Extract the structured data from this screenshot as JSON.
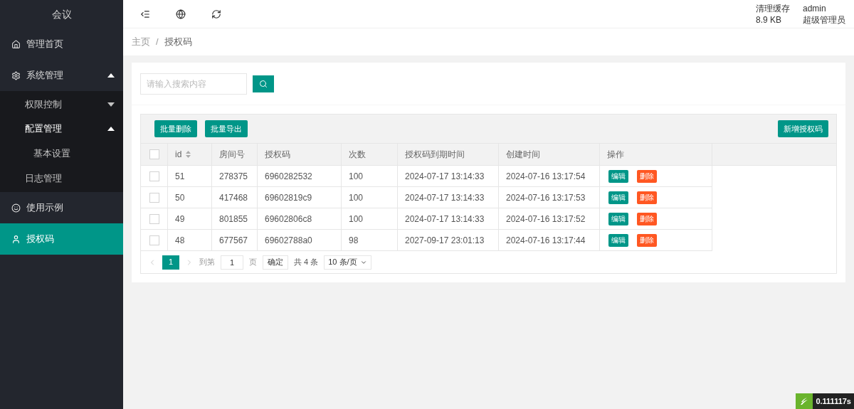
{
  "sidebar": {
    "title": "会议",
    "items": [
      {
        "label": "管理首页",
        "selected": false
      },
      {
        "label": "系统管理",
        "selected": false,
        "expanded": true,
        "children": [
          {
            "label": "权限控制",
            "expanded": false
          },
          {
            "label": "配置管理",
            "expanded": true,
            "children": [
              {
                "label": "基本设置"
              }
            ]
          },
          {
            "label": "日志管理"
          }
        ]
      },
      {
        "label": "使用示例",
        "selected": false
      },
      {
        "label": "授权码",
        "selected": true
      }
    ]
  },
  "header": {
    "cache_label": "清理缓存",
    "cache_size": "8.9 KB",
    "user": "admin",
    "role": "超级管理员"
  },
  "breadcrumb": {
    "separator": "/",
    "items": [
      "主页",
      "授权码"
    ]
  },
  "search": {
    "placeholder": "请输入搜索内容"
  },
  "toolbar": {
    "left_buttons": [
      "批量删除",
      "批量导出"
    ],
    "right_button": "新增授权码"
  },
  "table": {
    "select_all": false,
    "columns": [
      "id",
      "房间号",
      "授权码",
      "次数",
      "授权码到期时间",
      "创建时间",
      "操作"
    ],
    "rows": [
      {
        "checked": false,
        "cells": [
          "51",
          "278375",
          "6960282532",
          "100",
          "2024-07-17 13:14:33",
          "2024-07-16 13:17:54"
        ],
        "actions": [
          "编辑",
          "删除"
        ]
      },
      {
        "checked": false,
        "cells": [
          "50",
          "417468",
          "69602819c9",
          "100",
          "2024-07-17 13:14:33",
          "2024-07-16 13:17:53"
        ],
        "actions": [
          "编辑",
          "删除"
        ]
      },
      {
        "checked": false,
        "cells": [
          "49",
          "801855",
          "69602806c8",
          "100",
          "2024-07-17 13:14:33",
          "2024-07-16 13:17:52"
        ],
        "actions": [
          "编辑",
          "删除"
        ]
      },
      {
        "checked": false,
        "cells": [
          "48",
          "677567",
          "69602788a0",
          "98",
          "2027-09-17 23:01:13",
          "2024-07-16 13:17:44"
        ],
        "actions": [
          "编辑",
          "删除"
        ]
      }
    ]
  },
  "pagination": {
    "pages": [
      {
        "label": "1",
        "selected": true
      }
    ],
    "goto_label": "到第",
    "goto_value": "1",
    "page_unit": "页",
    "confirm": "确定",
    "total": "共 4 条",
    "page_size": "10 条/页"
  },
  "debug_badge": {
    "text": "0.111117s"
  }
}
